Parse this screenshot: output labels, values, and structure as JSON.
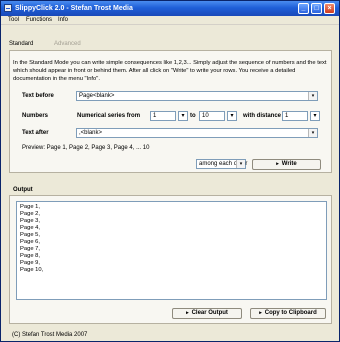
{
  "window": {
    "title": "SlippyClick 2.0 - Stefan Trost Media",
    "minimize": "_",
    "maximize": "□",
    "close": "×"
  },
  "menu": [
    "Tool",
    "Functions",
    "Info"
  ],
  "tabs": [
    "Standard",
    "Advanced"
  ],
  "info": "In the Standard Mode you can write simple consequences like 1,2,3... Simply adjust the sequence of numbers and the text which should appear in front or behind them. After all click on \"Write\" to write your rows. You receive a detailed documentation in the menu \"Info\".",
  "fields": {
    "text_before_label": "Text before",
    "text_before_value": "Page<blank>",
    "numbers_label": "Numbers",
    "numerical_series_label": "Numerical series from",
    "from_value": "1",
    "to_label": "to",
    "to_value": "10",
    "distance_label": "with distance",
    "distance_value": "1",
    "text_after_label": "Text after",
    "text_after_value": ",<blank>"
  },
  "preview": "Preview: Page 1, Page 2, Page 3, Page 4, ... 10",
  "write_mode": "among each other",
  "write_button": "Write",
  "output": {
    "label": "Output",
    "lines": [
      "Page 1,",
      "Page 2,",
      "Page 3,",
      "Page 4,",
      "Page 5,",
      "Page 6,",
      "Page 7,",
      "Page 8,",
      "Page 9,",
      "Page 10,"
    ]
  },
  "buttons": {
    "clear": "Clear Output",
    "copy": "Copy to Clipboard"
  },
  "footer": "(C) Stefan Trost Media 2007",
  "icons": {
    "dropdown": "▾",
    "arrow": "▸"
  }
}
